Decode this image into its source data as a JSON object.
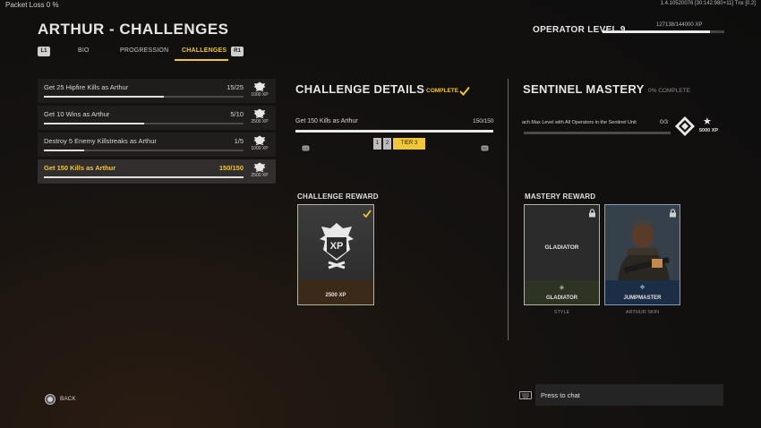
{
  "topbar": {
    "packet_loss": "Packet Loss 0 %",
    "version": "1.4.10520076 [30:142:980+11] Tnx [0.2]"
  },
  "page": {
    "title": "ARTHUR - CHALLENGES"
  },
  "operator": {
    "level_label": "OPERATOR LEVEL 9",
    "xp_text": "127138/144000 XP",
    "xp_progress": 0.883
  },
  "tabs": {
    "left_key": "L1",
    "right_key": "R1",
    "items": [
      {
        "label": "BIO"
      },
      {
        "label": "PROGRESSION"
      },
      {
        "label": "CHALLENGES"
      }
    ],
    "active": "CHALLENGES"
  },
  "challenges": [
    {
      "name": "Get 25 Hipfire Kills as Arthur",
      "progress_text": "15/25",
      "progress": 0.6,
      "reward": "1000 XP",
      "selected": false
    },
    {
      "name": "Get 10 Wins as Arthur",
      "progress_text": "5/10",
      "progress": 0.5,
      "reward": "2500 XP",
      "selected": false
    },
    {
      "name": "Destroy 5 Enemy Killstreaks as Arthur",
      "progress_text": "1/5",
      "progress": 0.2,
      "reward": "1000 XP",
      "selected": false
    },
    {
      "name": "Get 150 Kills as Arthur",
      "progress_text": "150/150",
      "progress": 1.0,
      "reward": "2500 XP",
      "selected": true
    }
  ],
  "challenge_details": {
    "title": "CHALLENGE DETAILS",
    "status": "COMPLETE",
    "name": "Get 150 Kills as Arthur",
    "progress_text": "150/150",
    "progress": 1.0,
    "tier_left_key": "L2",
    "tier_right_key": "R2",
    "tiers": [
      "1",
      "2",
      "TIER 3"
    ],
    "reward_label": "CHALLENGE REWARD",
    "reward_badge": "XP",
    "reward_xp": "2500 XP"
  },
  "mastery": {
    "title": "SENTINEL MASTERY",
    "percent": "0% COMPLETE",
    "objective": "ach Max Level with All Operators in the Sentinel Unit",
    "progress_text": "0/3",
    "progress": 0.0,
    "xp": "5000 XP",
    "reward_label": "MASTERY REWARD",
    "rewards": [
      {
        "center_text": "GLADIATOR",
        "footer": "GLADIATOR",
        "sub": "STYLE"
      },
      {
        "footer": "JUMPMASTER",
        "sub": "ARTHUR SKIN"
      }
    ]
  },
  "footer": {
    "back_label": "BACK",
    "chat_placeholder": "Press to chat"
  }
}
